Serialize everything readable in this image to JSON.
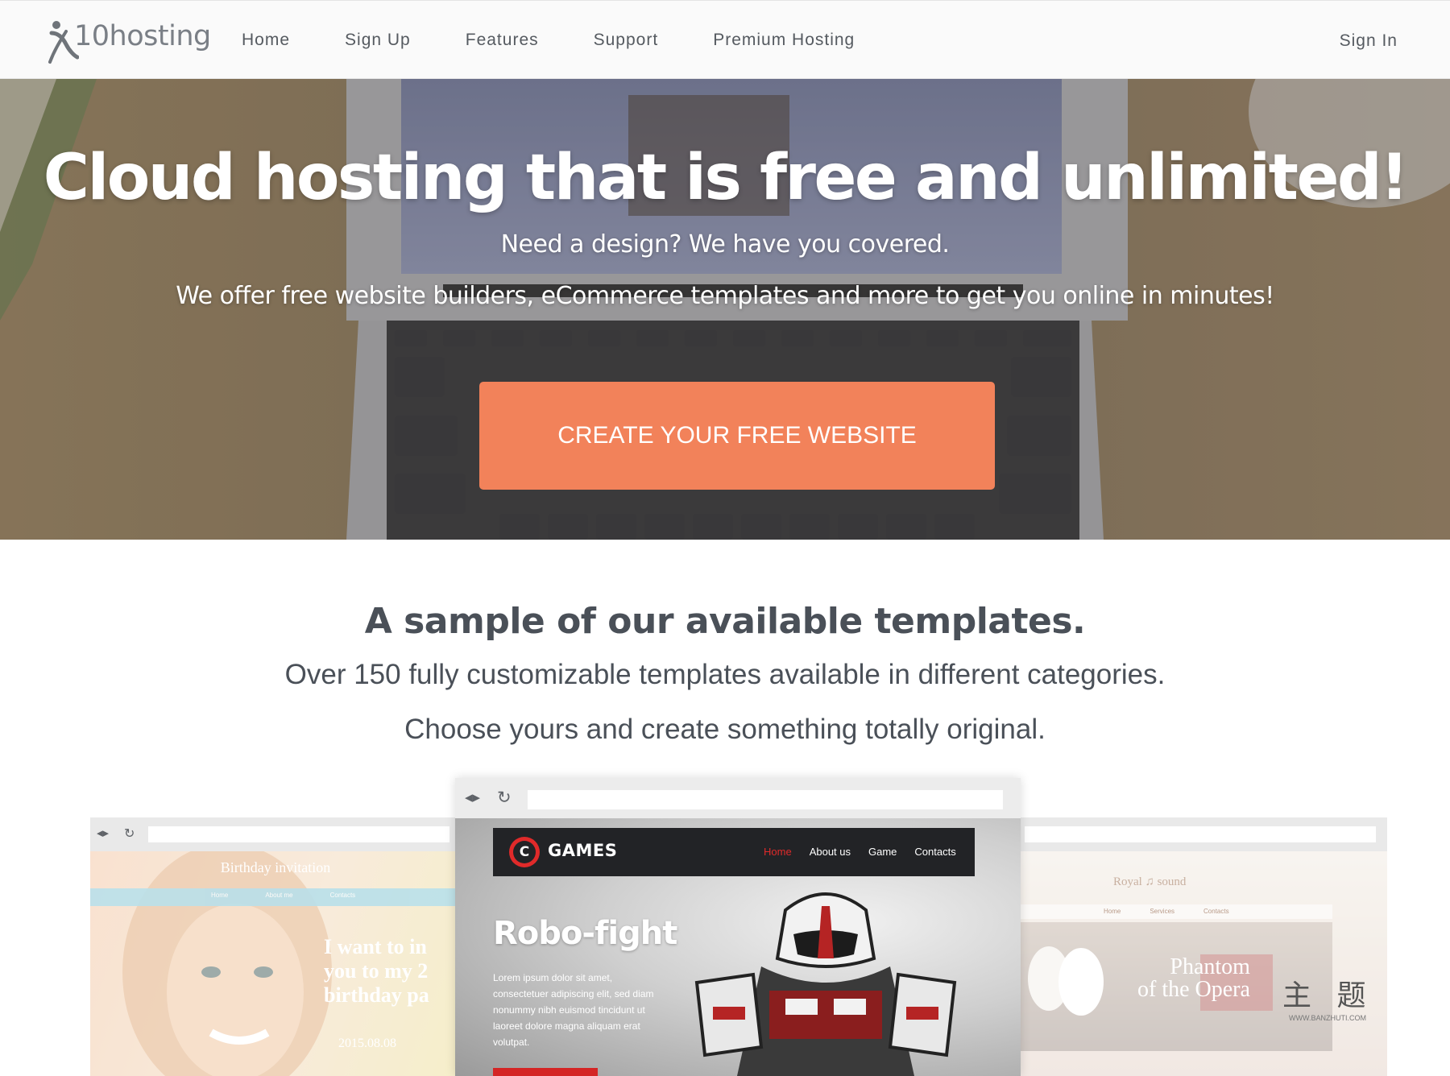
{
  "nav": {
    "logo_text": "10hosting",
    "links": [
      "Home",
      "Sign Up",
      "Features",
      "Support",
      "Premium Hosting"
    ],
    "sign_in": "Sign In"
  },
  "hero": {
    "title": "Cloud hosting that is free and unlimited!",
    "subtitle1": "Need a design? We have you covered.",
    "subtitle2": "We offer free website builders, eCommerce templates and more to get you online in minutes!",
    "cta_label": "CREATE YOUR FREE WEBSITE"
  },
  "templates": {
    "title": "A sample of our available templates.",
    "subtitle1": "Over 150 fully customizable templates available in different categories.",
    "subtitle2": "Choose yours and create something totally original."
  },
  "mock_left": {
    "brand": "Birthday invitation",
    "menu": [
      "Home",
      "About me",
      "Contacts"
    ],
    "heading_lines": [
      "I want to in",
      "you to my 2",
      "birthday pa"
    ],
    "date": "2015.08.08"
  },
  "mock_center": {
    "brand": "GAMES",
    "logo_letter": "C",
    "menu": [
      "Home",
      "About us",
      "Game",
      "Contacts"
    ],
    "headline": "Robo-fight",
    "body": "Lorem ipsum dolor sit amet, consectetuer adipiscing elit, sed diam nonummy nibh euismod tincidunt ut laoreet dolore magna aliquam erat volutpat."
  },
  "mock_right": {
    "brand": "Royal ♫ sound",
    "menu": [
      "Home",
      "Services",
      "Contacts"
    ],
    "title_lines": [
      "Phantom",
      "of the Opera"
    ],
    "watermark": "主 题",
    "watermark_url": "WWW.BANZHUTI.COM"
  },
  "colors": {
    "cta": "#f2825a",
    "nav_text": "#555a60",
    "heading": "#4a5058",
    "games_accent": "#e02a2a"
  },
  "icons": [
    "logo-figure-icon",
    "arrows-icon",
    "reload-icon",
    "robot-illustration"
  ]
}
